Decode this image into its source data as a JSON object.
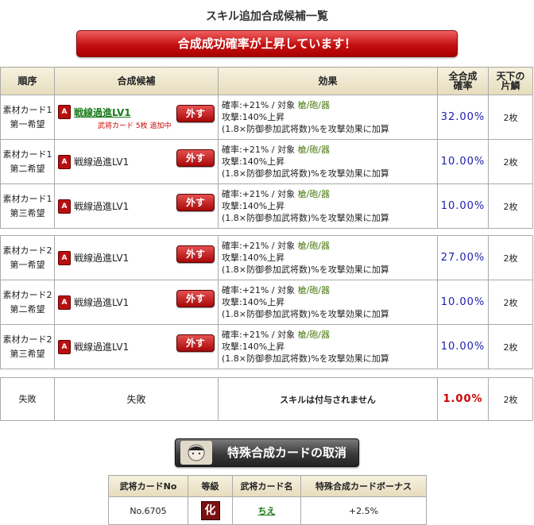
{
  "page": {
    "title": "スキル追加合成候補一覧"
  },
  "banner": {
    "text": "合成成功確率が上昇しています！"
  },
  "table": {
    "headers": {
      "order": "順序",
      "candidate": "合成候補",
      "effect": "効果",
      "prob": "全合成\n確率",
      "cost": "天下の\n片鱗"
    },
    "remove_label": "外す",
    "rows": [
      {
        "order1": "素材カード1",
        "order2": "第一希望",
        "skill": "戦線過進LV1",
        "note": "武将カード 5枚 追加中",
        "eff1": "確率:+21% / 対象 ",
        "eff1b": "槍/砲/器",
        "eff2": "攻撃:140%上昇",
        "eff3": "(1.8×防御参加武将数)%を攻撃効果に加算",
        "prob": "32.00%",
        "cost": "2枚"
      },
      {
        "order1": "素材カード1",
        "order2": "第二希望",
        "skill": "戦線過進LV1",
        "note": "",
        "eff1": "確率:+21% / 対象 ",
        "eff1b": "槍/砲/器",
        "eff2": "攻撃:140%上昇",
        "eff3": "(1.8×防御参加武将数)%を攻撃効果に加算",
        "prob": "10.00%",
        "cost": "2枚"
      },
      {
        "order1": "素材カード1",
        "order2": "第三希望",
        "skill": "戦線過進LV1",
        "note": "",
        "eff1": "確率:+21% / 対象 ",
        "eff1b": "槍/砲/器",
        "eff2": "攻撃:140%上昇",
        "eff3": "(1.8×防御参加武将数)%を攻撃効果に加算",
        "prob": "10.00%",
        "cost": "2枚"
      },
      {
        "order1": "素材カード2",
        "order2": "第一希望",
        "skill": "戦線過進LV1",
        "note": "",
        "eff1": "確率:+21% / 対象 ",
        "eff1b": "槍/砲/器",
        "eff2": "攻撃:140%上昇",
        "eff3": "(1.8×防御参加武将数)%を攻撃効果に加算",
        "prob": "27.00%",
        "cost": "2枚"
      },
      {
        "order1": "素材カード2",
        "order2": "第二希望",
        "skill": "戦線過進LV1",
        "note": "",
        "eff1": "確率:+21% / 対象 ",
        "eff1b": "槍/砲/器",
        "eff2": "攻撃:140%上昇",
        "eff3": "(1.8×防御参加武将数)%を攻撃効果に加算",
        "prob": "10.00%",
        "cost": "2枚"
      },
      {
        "order1": "素材カード2",
        "order2": "第三希望",
        "skill": "戦線過進LV1",
        "note": "",
        "eff1": "確率:+21% / 対象 ",
        "eff1b": "槍/砲/器",
        "eff2": "攻撃:140%上昇",
        "eff3": "(1.8×防御参加武将数)%を攻撃効果に加算",
        "prob": "10.00%",
        "cost": "2枚"
      }
    ],
    "fail": {
      "order": "失敗",
      "candidate": "失敗",
      "effect": "スキルは付与されません",
      "prob": "1.00%",
      "cost": "2枚"
    }
  },
  "cancel_button": {
    "label": "特殊合成カードの取消"
  },
  "card_table": {
    "headers": {
      "no": "武将カードNo",
      "grade": "等級",
      "name": "武将カード名",
      "bonus": "特殊合成カードボーナス"
    },
    "row": {
      "no": "No.6705",
      "grade": "化",
      "name": "ちえ",
      "bonus": "+2.5%"
    }
  },
  "colors": {
    "banner": "#c41010",
    "remove": "#a80808",
    "prob": "#1c1cb0",
    "troops": "#4a7a10"
  }
}
